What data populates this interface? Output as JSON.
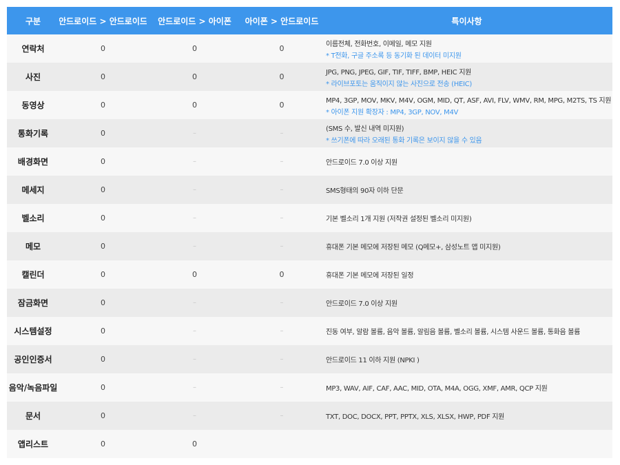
{
  "header": {
    "category": "구분",
    "android_to_android": "안드로이드 > 안드로이드",
    "android_to_iphone": "안드로이드 > 아이폰",
    "iphone_to_android": "아이폰 > 안드로이드",
    "notes": "특이사항"
  },
  "rows": [
    {
      "category": "연락처",
      "a2a": "0",
      "a2i": "0",
      "i2a": "0",
      "note": "이름전체, 전화번호, 이메일, 메모 지원",
      "sub_note": "*  T전화, 구글 주소록 등 동기화 된 데이터 미지원"
    },
    {
      "category": "사진",
      "a2a": "0",
      "a2i": "0",
      "i2a": "0",
      "note": "JPG, PNG, JPEG, GIF, TIF, TIFF, BMP, HEIC 지원",
      "sub_note": "* 라이브포토는 움직이지 않는 사진으로 전송 (HEIC)"
    },
    {
      "category": "동영상",
      "a2a": "0",
      "a2i": "0",
      "i2a": "0",
      "note": "MP4, 3GP, MOV, MKV, M4V, OGM, MID, QT, ASF, AVI, FLV, WMV, RM, MPG, M2TS, TS 지원",
      "sub_note": "* 아이폰 지원 확장자 : MP4, 3GP, NOV, M4V"
    },
    {
      "category": "통화기록",
      "a2a": "0",
      "a2i": "–",
      "i2a": "–",
      "note": "(SMS 수, 발신 내역 미지원)",
      "sub_note": "* 쓰기폰에 따라 오래된 통화 기록은 보이지 않을 수 있음"
    },
    {
      "category": "배경화면",
      "a2a": "0",
      "a2i": "–",
      "i2a": "–",
      "note": "안드로이드 7.0 이상 지원",
      "sub_note": ""
    },
    {
      "category": "메세지",
      "a2a": "0",
      "a2i": "–",
      "i2a": "–",
      "note": "SMS형태의 90자 이하 단문",
      "sub_note": ""
    },
    {
      "category": "벨소리",
      "a2a": "0",
      "a2i": "–",
      "i2a": "–",
      "note": "기본 벨소리 1개 지원 (저작권 설정된 벨소리 미지원)",
      "sub_note": ""
    },
    {
      "category": "메모",
      "a2a": "0",
      "a2i": "–",
      "i2a": "–",
      "note": "휴대폰 기본 메모에 저장된 메모 (Q메모+, 삼성노트 앱 미지원)",
      "sub_note": ""
    },
    {
      "category": "캘린더",
      "a2a": "0",
      "a2i": "0",
      "i2a": "0",
      "note": "휴대폰 기본 메모에 저장된 일정",
      "sub_note": ""
    },
    {
      "category": "잠금화면",
      "a2a": "0",
      "a2i": "–",
      "i2a": "–",
      "note": "안드로이드 7.0 이상 지원",
      "sub_note": ""
    },
    {
      "category": "시스템설정",
      "a2a": "0",
      "a2i": "–",
      "i2a": "–",
      "note": "진동 여부, 알람 볼륨, 음악 볼륨, 알림음 볼륨, 벨소리 볼륨, 시스템 사운드 볼륨, 통화음 볼륨",
      "sub_note": ""
    },
    {
      "category": "공인인증서",
      "a2a": "0",
      "a2i": "–",
      "i2a": "–",
      "note": "안드로이드 11 이하 지원 (NPKI )",
      "sub_note": ""
    },
    {
      "category": "음악/녹음파일",
      "a2a": "0",
      "a2i": "–",
      "i2a": "–",
      "note": "MP3, WAV, AIF, CAF, AAC, MID, OTA, M4A, OGG, XMF, AMR, QCP 지원",
      "sub_note": ""
    },
    {
      "category": "문서",
      "a2a": "0",
      "a2i": "–",
      "i2a": "–",
      "note": "TXT, DOC, DOCX, PPT, PPTX, XLS, XLSX, HWP, PDF 지원",
      "sub_note": ""
    },
    {
      "category": "앱리스트",
      "a2a": "0",
      "a2i": "0",
      "i2a": "",
      "note": "",
      "sub_note": ""
    }
  ]
}
